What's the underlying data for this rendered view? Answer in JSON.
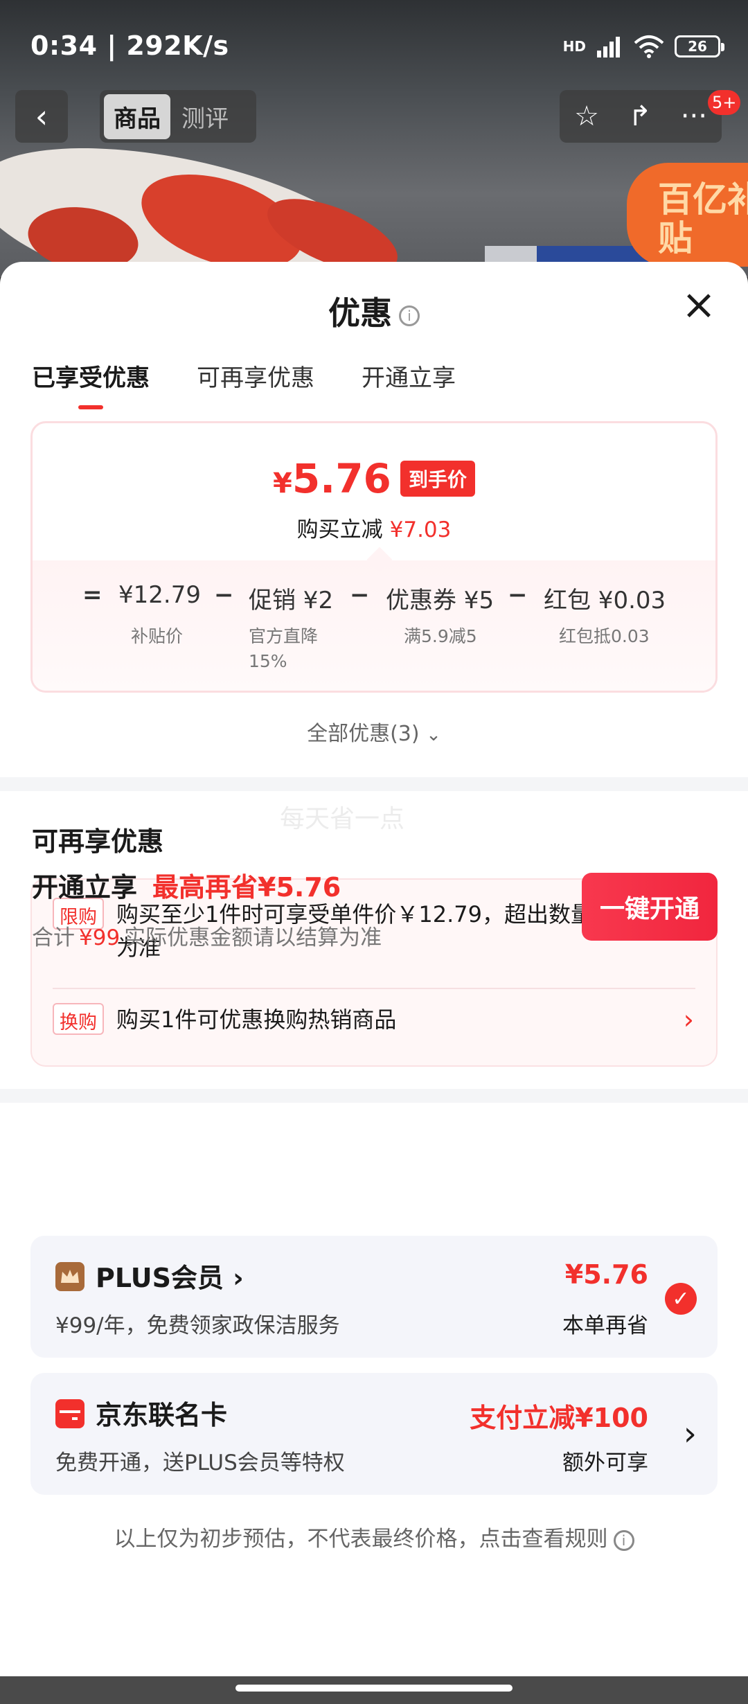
{
  "status_bar": {
    "time": "0:34 | 292K/s",
    "network": "HD",
    "battery": "26"
  },
  "nav": {
    "tabs": [
      {
        "label": "商品"
      },
      {
        "label": "测评"
      }
    ],
    "badge": "5+"
  },
  "background": {
    "promo_badge": "百亿补贴"
  },
  "sheet": {
    "title": "优惠",
    "tabs": [
      {
        "label": "已享受优惠"
      },
      {
        "label": "可再享优惠"
      },
      {
        "label": "开通立享"
      }
    ],
    "price_card": {
      "currency": "¥",
      "price": "5.76",
      "tag": "到手价",
      "discount_label": "购买立减",
      "discount_value": "¥7.03",
      "breakdown": {
        "eq": "=",
        "base": {
          "value": "¥12.79",
          "sub": "补贴价"
        },
        "minus": "−",
        "promo": {
          "value": "促销 ¥2",
          "sub1": "官方直降",
          "sub2": "15%"
        },
        "coupon": {
          "value": "优惠券 ¥5",
          "sub": "满5.9减5"
        },
        "redpacket": {
          "value": "红包 ¥0.03",
          "sub": "红包抵0.03"
        }
      }
    },
    "all_promos": "全部优惠(3)",
    "watermark": "每天省一点",
    "more_section": {
      "title": "可再享优惠",
      "items": [
        {
          "tag": "限购",
          "text": "购买至少1件时可享受单件价￥12.79，超出数量以结算价为准"
        },
        {
          "tag": "换购",
          "text": "购买1件可优惠换购热销商品"
        }
      ]
    },
    "open_section": {
      "title": "开通立享",
      "highlight": "最高再省¥5.76",
      "sub_prefix": "合计",
      "sub_amount": "¥99",
      "sub_suffix": "实际优惠金额请以结算为准",
      "button": "一键开通",
      "cards": [
        {
          "name": "PLUS会员 ›",
          "desc": "¥99/年，免费领家政保洁服务",
          "value": "¥5.76",
          "value_sub": "本单再省",
          "icon": "crown-icon",
          "icon_color": "#a86a3a"
        },
        {
          "name": "京东联名卡",
          "desc": "免费开通，送PLUS会员等特权",
          "value": "支付立减¥100",
          "value_sub": "额外可享",
          "icon": "card-icon",
          "icon_color": "#f2302c"
        }
      ]
    },
    "footnote": "以上仅为初步预估，不代表最终价格，点击查看规则"
  },
  "colors": {
    "accent": "#f2302c",
    "card_bg": "#f4f5fa"
  }
}
